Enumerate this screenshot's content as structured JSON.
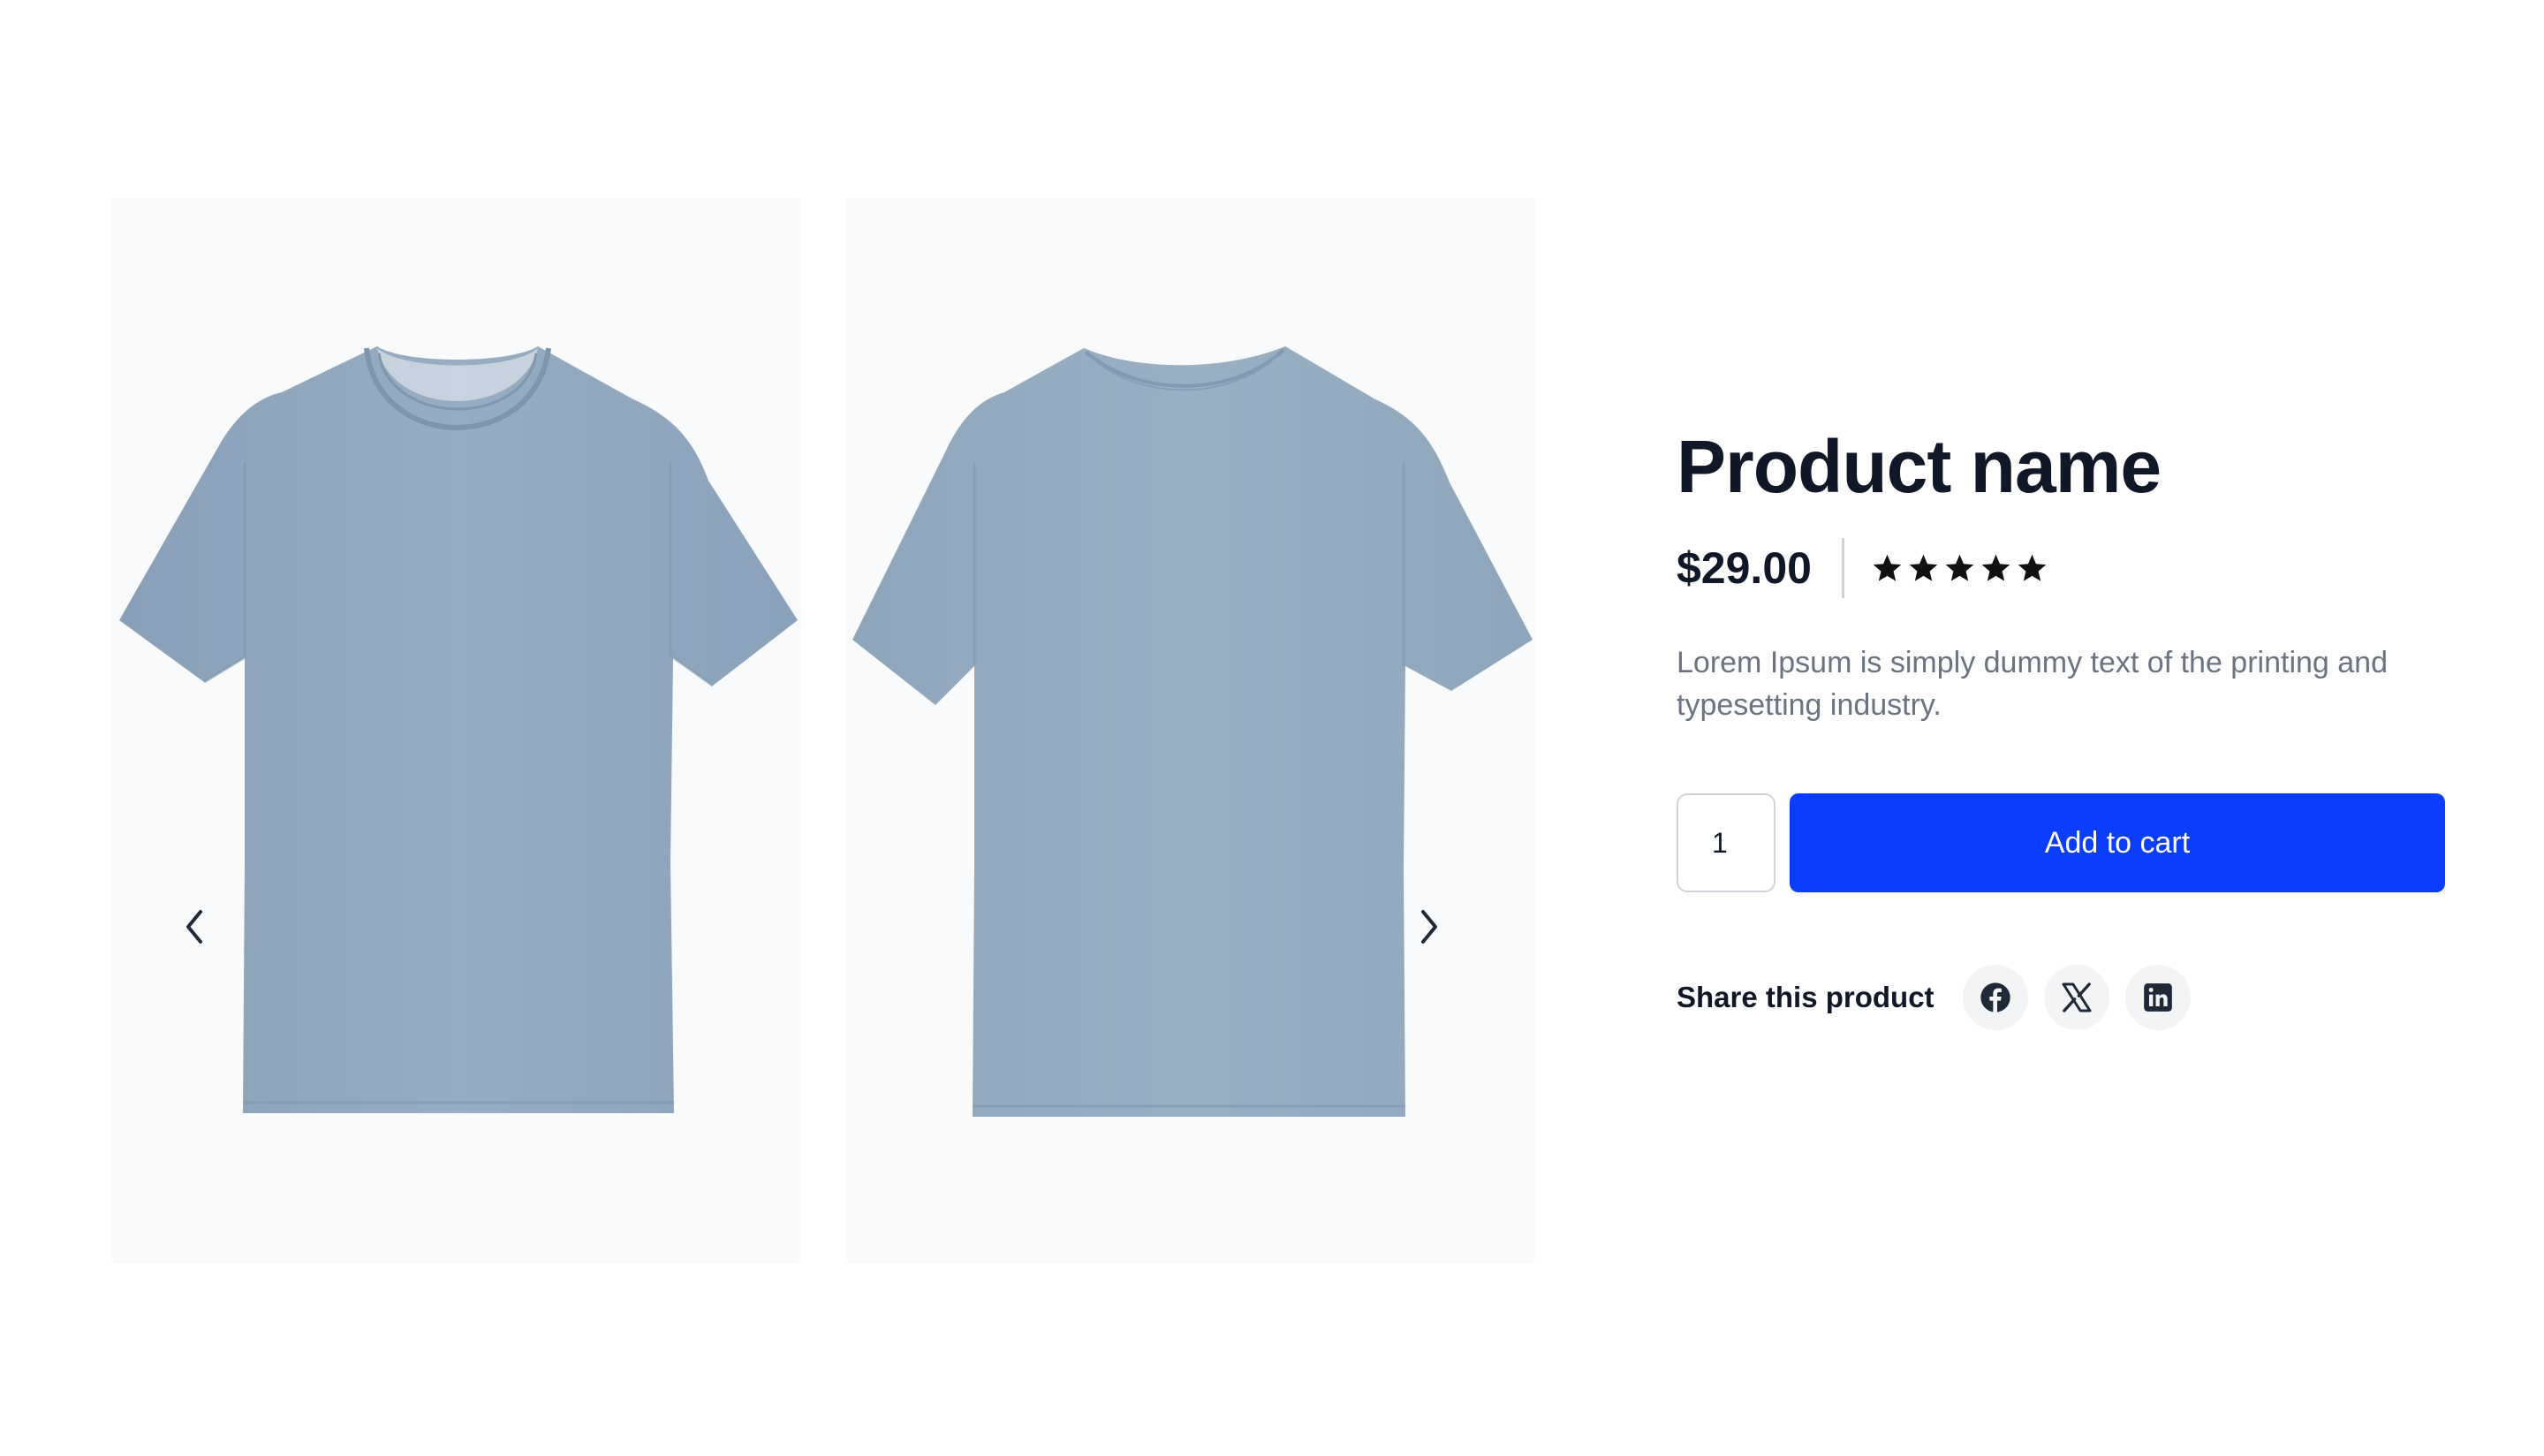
{
  "product": {
    "name": "Product name",
    "price": "$29.00",
    "rating": 5,
    "rating_max": 5,
    "description": "Lorem Ipsum is simply dummy text of the printing and typesetting industry."
  },
  "gallery": {
    "images": [
      {
        "view": "front",
        "icon": "tshirt-front-image"
      },
      {
        "view": "back",
        "icon": "tshirt-back-image"
      }
    ],
    "prev_icon": "chevron-left-icon",
    "next_icon": "chevron-right-icon"
  },
  "cart": {
    "quantity": "1",
    "add_label": "Add to cart"
  },
  "share": {
    "label": "Share this product",
    "networks": [
      {
        "name": "facebook",
        "icon": "facebook-icon"
      },
      {
        "name": "x",
        "icon": "x-icon"
      },
      {
        "name": "linkedin",
        "icon": "linkedin-icon"
      }
    ]
  },
  "colors": {
    "accent": "#0b3dff",
    "heading": "#101827",
    "muted_text": "#6b7280",
    "image_background": "#f9fafb",
    "tshirt": "#93aac0"
  }
}
